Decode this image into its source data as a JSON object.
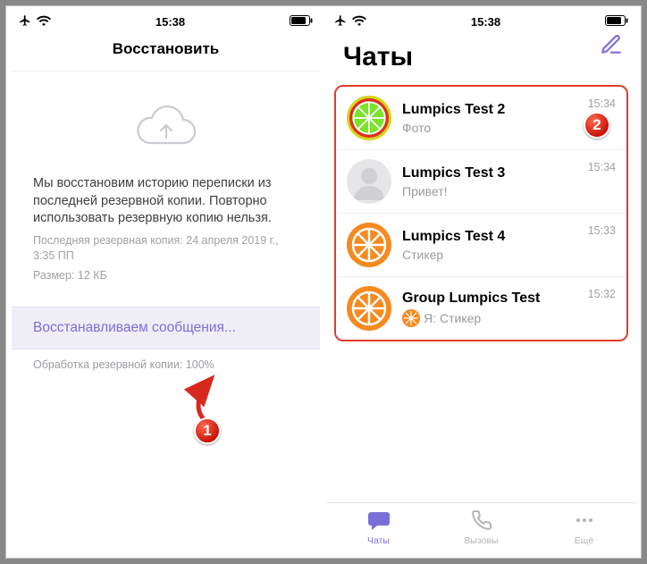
{
  "statusbar": {
    "time": "15:38"
  },
  "restore": {
    "title": "Восстановить",
    "description": "Мы восстановим историю переписки из последней резервной копии. Повторно использовать резервную копию нельзя.",
    "last_backup_label": "Последняя резервная копия: 24 апреля 2019 г., 3:35 ПП",
    "size_label": "Размер: 12 КБ",
    "progress_label": "Восстанавливаем сообщения...",
    "processing_label": "Обработка резервной копии: 100%"
  },
  "chats": {
    "title": "Чаты",
    "items": [
      {
        "name": "Lumpics Test 2",
        "subtitle": "Фото",
        "time": "15:34",
        "avatar": "lime"
      },
      {
        "name": "Lumpics Test 3",
        "subtitle": "Привет!",
        "time": "15:34",
        "avatar": "gray"
      },
      {
        "name": "Lumpics Test 4",
        "subtitle": "Стикер",
        "time": "15:33",
        "avatar": "orange"
      },
      {
        "name": "Group Lumpics Test",
        "prefix": "Я:",
        "subtitle": "Стикер",
        "time": "15:32",
        "avatar": "orange",
        "mini": true
      }
    ]
  },
  "tabs": {
    "chats": "Чаты",
    "calls": "Вызовы",
    "more": "Ещё"
  },
  "annotations": {
    "one": "1",
    "two": "2"
  }
}
